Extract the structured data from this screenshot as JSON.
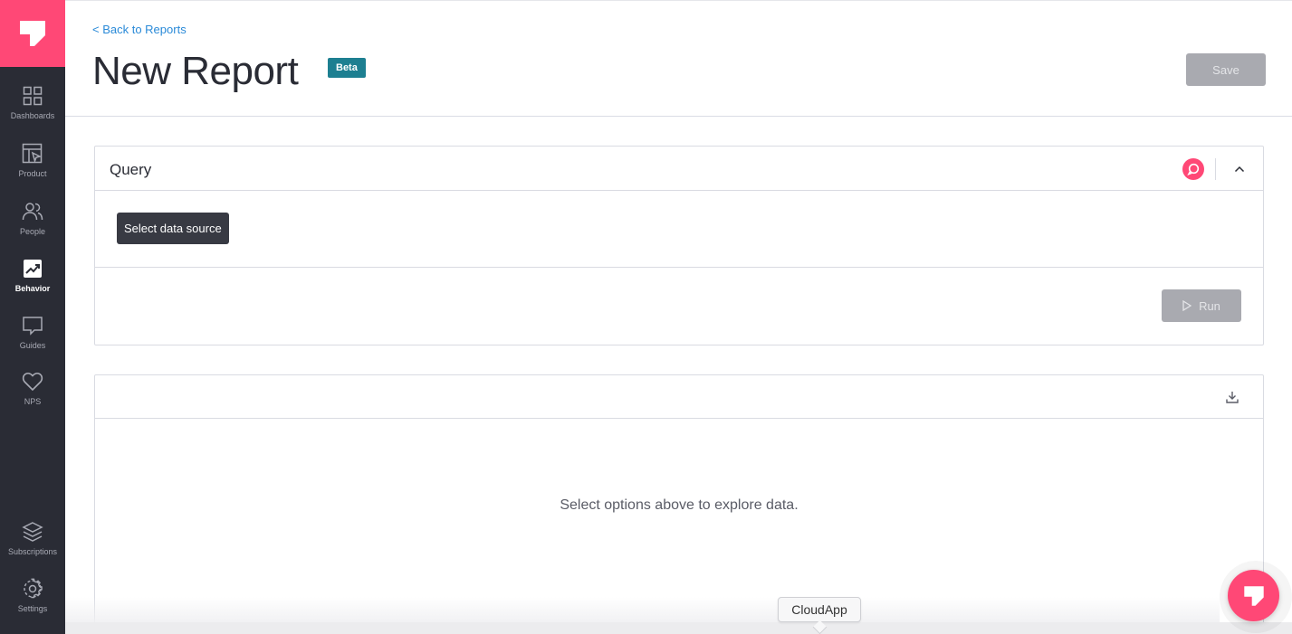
{
  "app": {
    "brand_color": "#ff4876",
    "sidebar_bg": "#2a2c35"
  },
  "sidebar": {
    "logo_icon": "pendo-logo-icon",
    "items": [
      {
        "label": "Dashboards",
        "icon": "dashboards-grid-icon",
        "active": false
      },
      {
        "label": "Product",
        "icon": "product-cursor-icon",
        "active": false
      },
      {
        "label": "People",
        "icon": "people-icon",
        "active": false
      },
      {
        "label": "Behavior",
        "icon": "behavior-trend-icon",
        "active": true
      },
      {
        "label": "Guides",
        "icon": "guides-speech-bubble-icon",
        "active": false
      },
      {
        "label": "NPS",
        "icon": "nps-heart-icon",
        "active": false
      },
      {
        "label": "Subscriptions",
        "icon": "subscriptions-layers-icon",
        "active": false
      },
      {
        "label": "Settings",
        "icon": "settings-gear-icon",
        "active": false
      }
    ]
  },
  "header": {
    "back_link": "< Back to Reports",
    "title": "New Report",
    "badge": "Beta",
    "save_label": "Save"
  },
  "query": {
    "title": "Query",
    "select_source_label": "Select data source",
    "run_label": "Run"
  },
  "results": {
    "empty_message": "Select options above to explore data."
  },
  "overlay": {
    "tooltip": "CloudApp"
  }
}
